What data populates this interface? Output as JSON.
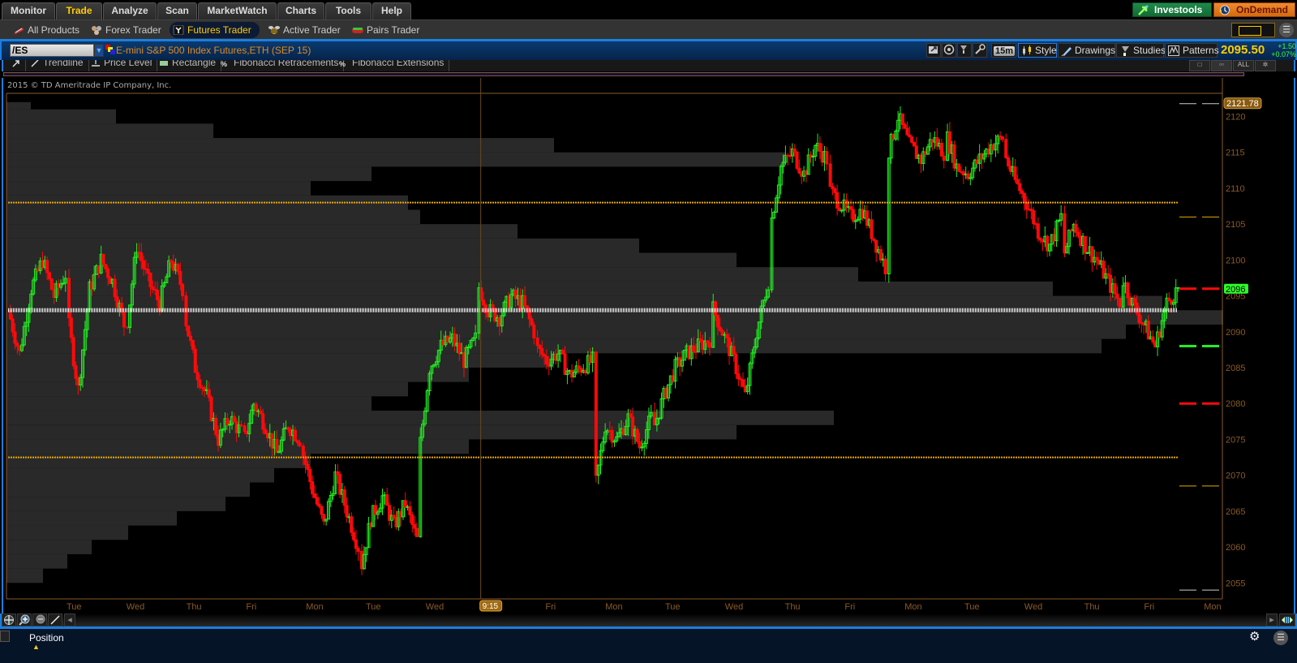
{
  "top_nav": {
    "tabs": [
      {
        "label": "Monitor",
        "active": false
      },
      {
        "label": "Trade",
        "active": true
      },
      {
        "label": "Analyze",
        "active": false
      },
      {
        "label": "Scan",
        "active": false
      },
      {
        "label": "MarketWatch",
        "active": false
      },
      {
        "label": "Charts",
        "active": false
      },
      {
        "label": "Tools",
        "active": false
      },
      {
        "label": "Help",
        "active": false
      }
    ],
    "investools_label": "Investools",
    "ondemand_label": "OnDemand"
  },
  "sub_nav": {
    "items": [
      {
        "label": "All Products",
        "icon": "all-products-icon",
        "active": false
      },
      {
        "label": "Forex Trader",
        "icon": "forex-icon",
        "active": false
      },
      {
        "label": "Futures Trader",
        "icon": "futures-icon",
        "active": true
      },
      {
        "label": "Active Trader",
        "icon": "bee-icon",
        "active": false
      },
      {
        "label": "Pairs Trader",
        "icon": "pairs-icon",
        "active": false
      }
    ]
  },
  "chart_header": {
    "symbol": "/ES",
    "instrument_name": "E-mini S&P 500 Index Futures,ETH (SEP 15)",
    "timeframe": "15m",
    "buttons": {
      "style": "Style",
      "drawings": "Drawings",
      "studies": "Studies",
      "patterns": "Patterns"
    },
    "last_price": "2095.50",
    "net_change": "+1.50",
    "net_change_pct": "+0.07%"
  },
  "drawing_toolbar": {
    "tools": [
      "Trendline",
      "Price Level",
      "Rectangle",
      "Fibonacci Retracements",
      "Fibonacci Extensions"
    ],
    "view_buttons": [
      "single",
      "grid",
      "ALL",
      "settings"
    ]
  },
  "chart": {
    "copyright": "2015 © TD Ameritrade IP Company, Inc.",
    "crosshair_time": "9:15",
    "high_label": "2121.78",
    "last_label": "2096",
    "colors": {
      "up": "#22ee22",
      "down": "#ff0a0a",
      "level_line": "#e8a800",
      "poc_line": "#ffffff",
      "volume_profile": "#292929",
      "axis_text": "#8a5a28",
      "axis_line": "#8a5a28",
      "high_badge": "#8a5a10"
    }
  },
  "chart_data": {
    "type": "candlestick",
    "symbol": "/ES",
    "interval": "15m",
    "ylim": [
      2053,
      2123
    ],
    "y_ticks": [
      2055,
      2060,
      2065,
      2070,
      2075,
      2080,
      2085,
      2090,
      2095,
      2100,
      2105,
      2110,
      2115,
      2120
    ],
    "x_tick_labels": [
      "Tue",
      "Wed",
      "Thu",
      "Fri",
      "Mon",
      "Tue",
      "Wed",
      "Thu",
      "Fri",
      "Mon",
      "Tue",
      "Wed",
      "Thu",
      "Fri",
      "Mon",
      "Tue",
      "Wed",
      "Thu",
      "Fri",
      "Mon"
    ],
    "price_path": [
      {
        "day": "Mon",
        "prices": [
          2093,
          2087,
          2096,
          2100,
          2095,
          2098
        ]
      },
      {
        "day": "Tue",
        "prices": [
          2093,
          2082,
          2096,
          2100,
          2097,
          2091
        ]
      },
      {
        "day": "Wed",
        "prices": [
          2089,
          2102,
          2097,
          2094,
          2100,
          2096
        ]
      },
      {
        "day": "Thu",
        "prices": [
          2093,
          2085,
          2081,
          2075,
          2078,
          2076
        ]
      },
      {
        "day": "Fri",
        "prices": [
          2074,
          2080,
          2077,
          2073,
          2077,
          2075
        ]
      },
      {
        "day": "Mon",
        "prices": [
          2074,
          2068,
          2063,
          2070,
          2065,
          2060
        ]
      },
      {
        "day": "Tue",
        "prices": [
          2056,
          2064,
          2067,
          2063,
          2066,
          2061
        ]
      },
      {
        "day": "Wed",
        "prices": [
          2072,
          2085,
          2088,
          2089,
          2086,
          2089
        ]
      },
      {
        "day": "Thu",
        "prices": [
          2097,
          2093,
          2092,
          2095,
          2094,
          2090
        ]
      },
      {
        "day": "Fri",
        "prices": [
          2088,
          2086,
          2087,
          2084,
          2085,
          2086
        ]
      },
      {
        "day": "Mon",
        "prices": [
          2067,
          2077,
          2075,
          2078,
          2074,
          2078
        ]
      },
      {
        "day": "Tue",
        "prices": [
          2076,
          2081,
          2085,
          2087,
          2088,
          2089
        ]
      },
      {
        "day": "Wed",
        "prices": [
          2094,
          2090,
          2086,
          2081,
          2090,
          2097
        ]
      },
      {
        "day": "Thu",
        "prices": [
          2104,
          2113,
          2115,
          2112,
          2116,
          2114
        ]
      },
      {
        "day": "Fri",
        "prices": [
          2110,
          2108,
          2106,
          2107,
          2103,
          2099
        ]
      },
      {
        "day": "Mon",
        "prices": [
          2114,
          2120,
          2116,
          2114,
          2117,
          2115
        ]
      },
      {
        "day": "Tue",
        "prices": [
          2118,
          2113,
          2112,
          2114,
          2116,
          2117
        ]
      },
      {
        "day": "Wed",
        "prices": [
          2115,
          2111,
          2108,
          2104,
          2102,
          2106
        ]
      },
      {
        "day": "Thu",
        "prices": [
          2100,
          2105,
          2102,
          2100,
          2097,
          2094
        ]
      },
      {
        "day": "Fri",
        "prices": [
          2098,
          2094,
          2091,
          2088,
          2094,
          2096
        ]
      }
    ],
    "horizontal_levels": [
      {
        "name": "resistance",
        "price": 2108.0,
        "color": "#e8a800"
      },
      {
        "name": "point-of-control",
        "price": 2093.0,
        "color": "#ffffff"
      },
      {
        "name": "support",
        "price": 2072.5,
        "color": "#e8a800"
      }
    ],
    "right_markers": [
      {
        "price": 2121.78,
        "color": "#cccccc"
      },
      {
        "price": 2106.0,
        "color": "#e8a800"
      },
      {
        "price": 2096.0,
        "color": "#ff0a0a"
      },
      {
        "price": 2088.0,
        "color": "#22ee22"
      },
      {
        "price": 2080.0,
        "color": "#ff0a0a"
      },
      {
        "price": 2068.5,
        "color": "#e8a800"
      },
      {
        "price": 2054.0,
        "color": "#cccccc"
      }
    ],
    "volume_profile": [
      {
        "lo": 2121,
        "hi": 2122,
        "rel": 0.02
      },
      {
        "lo": 2119,
        "hi": 2121,
        "rel": 0.09
      },
      {
        "lo": 2117,
        "hi": 2119,
        "rel": 0.17
      },
      {
        "lo": 2115,
        "hi": 2117,
        "rel": 0.45
      },
      {
        "lo": 2113,
        "hi": 2115,
        "rel": 0.64
      },
      {
        "lo": 2111,
        "hi": 2113,
        "rel": 0.3
      },
      {
        "lo": 2109,
        "hi": 2111,
        "rel": 0.25
      },
      {
        "lo": 2107,
        "hi": 2109,
        "rel": 0.33
      },
      {
        "lo": 2105,
        "hi": 2107,
        "rel": 0.34
      },
      {
        "lo": 2103,
        "hi": 2105,
        "rel": 0.42
      },
      {
        "lo": 2101,
        "hi": 2103,
        "rel": 0.52
      },
      {
        "lo": 2099,
        "hi": 2101,
        "rel": 0.6
      },
      {
        "lo": 2097,
        "hi": 2099,
        "rel": 0.7
      },
      {
        "lo": 2095,
        "hi": 2097,
        "rel": 0.86
      },
      {
        "lo": 2093,
        "hi": 2095,
        "rel": 0.95
      },
      {
        "lo": 2091,
        "hi": 2093,
        "rel": 1.0
      },
      {
        "lo": 2089,
        "hi": 2091,
        "rel": 0.92
      },
      {
        "lo": 2087,
        "hi": 2089,
        "rel": 0.9
      },
      {
        "lo": 2085,
        "hi": 2087,
        "rel": 0.45
      },
      {
        "lo": 2083,
        "hi": 2085,
        "rel": 0.38
      },
      {
        "lo": 2081,
        "hi": 2083,
        "rel": 0.33
      },
      {
        "lo": 2079,
        "hi": 2081,
        "rel": 0.3
      },
      {
        "lo": 2077,
        "hi": 2079,
        "rel": 0.68
      },
      {
        "lo": 2075,
        "hi": 2077,
        "rel": 0.6
      },
      {
        "lo": 2073,
        "hi": 2075,
        "rel": 0.38
      },
      {
        "lo": 2071,
        "hi": 2073,
        "rel": 0.25
      },
      {
        "lo": 2069,
        "hi": 2071,
        "rel": 0.22
      },
      {
        "lo": 2067,
        "hi": 2069,
        "rel": 0.2
      },
      {
        "lo": 2065,
        "hi": 2067,
        "rel": 0.18
      },
      {
        "lo": 2063,
        "hi": 2065,
        "rel": 0.14
      },
      {
        "lo": 2061,
        "hi": 2063,
        "rel": 0.1
      },
      {
        "lo": 2059,
        "hi": 2061,
        "rel": 0.07
      },
      {
        "lo": 2057,
        "hi": 2059,
        "rel": 0.05
      },
      {
        "lo": 2055,
        "hi": 2057,
        "rel": 0.03
      }
    ],
    "crosshair": {
      "time_label": "9:15",
      "session_index": 8
    }
  },
  "bottom_tools": {
    "buttons": [
      "crosshair",
      "zoom-in",
      "zoom-out",
      "drawing-line",
      "scroll-left"
    ],
    "right_buttons": [
      "scroll-right",
      "expand"
    ]
  },
  "position_bar": {
    "label": "Position"
  }
}
